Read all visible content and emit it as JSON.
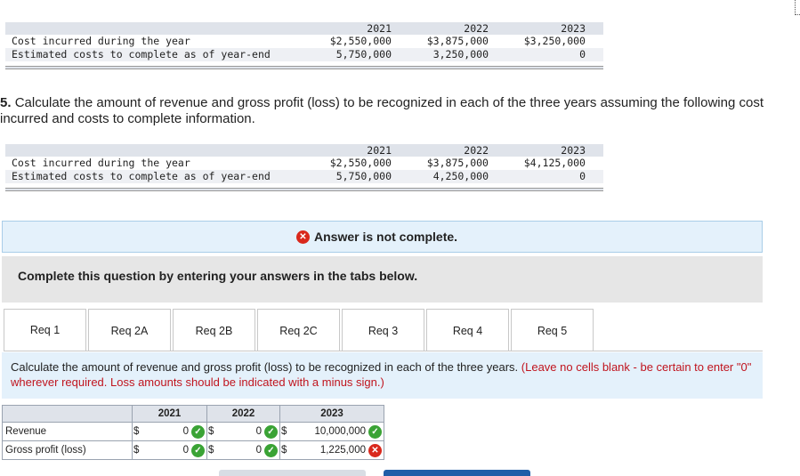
{
  "table1": {
    "years": [
      "2021",
      "2022",
      "2023"
    ],
    "rows": [
      {
        "label": "Cost incurred during the year",
        "values": [
          "$2,550,000",
          "$3,875,000",
          "$3,250,000"
        ]
      },
      {
        "label": "Estimated costs to complete as of year-end",
        "values": [
          "5,750,000",
          "3,250,000",
          "0"
        ]
      }
    ]
  },
  "question5": {
    "number": "5.",
    "text": "Calculate the amount of revenue and gross profit (loss) to be recognized in each of the three years assuming the following cost",
    "text2": "incurred and costs to complete information."
  },
  "table2": {
    "years": [
      "2021",
      "2022",
      "2023"
    ],
    "rows": [
      {
        "label": "Cost incurred during the year",
        "values": [
          "$2,550,000",
          "$3,875,000",
          "$4,125,000"
        ]
      },
      {
        "label": "Estimated costs to complete as of year-end",
        "values": [
          "5,750,000",
          "4,250,000",
          "0"
        ]
      }
    ]
  },
  "banner": {
    "text": "Answer is not complete."
  },
  "complete_box": {
    "text": "Complete this question by entering your answers in the tabs below."
  },
  "tabs": [
    {
      "label": "Req 1"
    },
    {
      "label": "Req 2A"
    },
    {
      "label": "Req 2B"
    },
    {
      "label": "Req 2C"
    },
    {
      "label": "Req 3"
    },
    {
      "label": "Req 4"
    },
    {
      "label": "Req 5"
    }
  ],
  "instruction": {
    "text": "Calculate the amount of revenue and gross profit (loss) to be recognized in each of the three years. ",
    "red": "(Leave no cells blank - be certain to enter \"0\" wherever required. Loss amounts should be indicated with a minus sign.)"
  },
  "answer_table": {
    "headers": [
      "2021",
      "2022",
      "2023"
    ],
    "currency": "$",
    "rows": [
      {
        "label": "Revenue",
        "values": [
          "0",
          "0",
          "10,000,000"
        ],
        "status": [
          "correct",
          "correct",
          "correct"
        ]
      },
      {
        "label": "Gross profit (loss)",
        "values": [
          "0",
          "0",
          "1,225,000"
        ],
        "status": [
          "correct",
          "correct",
          "incorrect"
        ]
      }
    ]
  },
  "colors": {
    "correct": "#3aa335",
    "incorrect": "#d9281c",
    "accent": "#1f5ea8"
  },
  "icons": {
    "correct": "check-circle-icon",
    "incorrect": "x-circle-icon"
  }
}
